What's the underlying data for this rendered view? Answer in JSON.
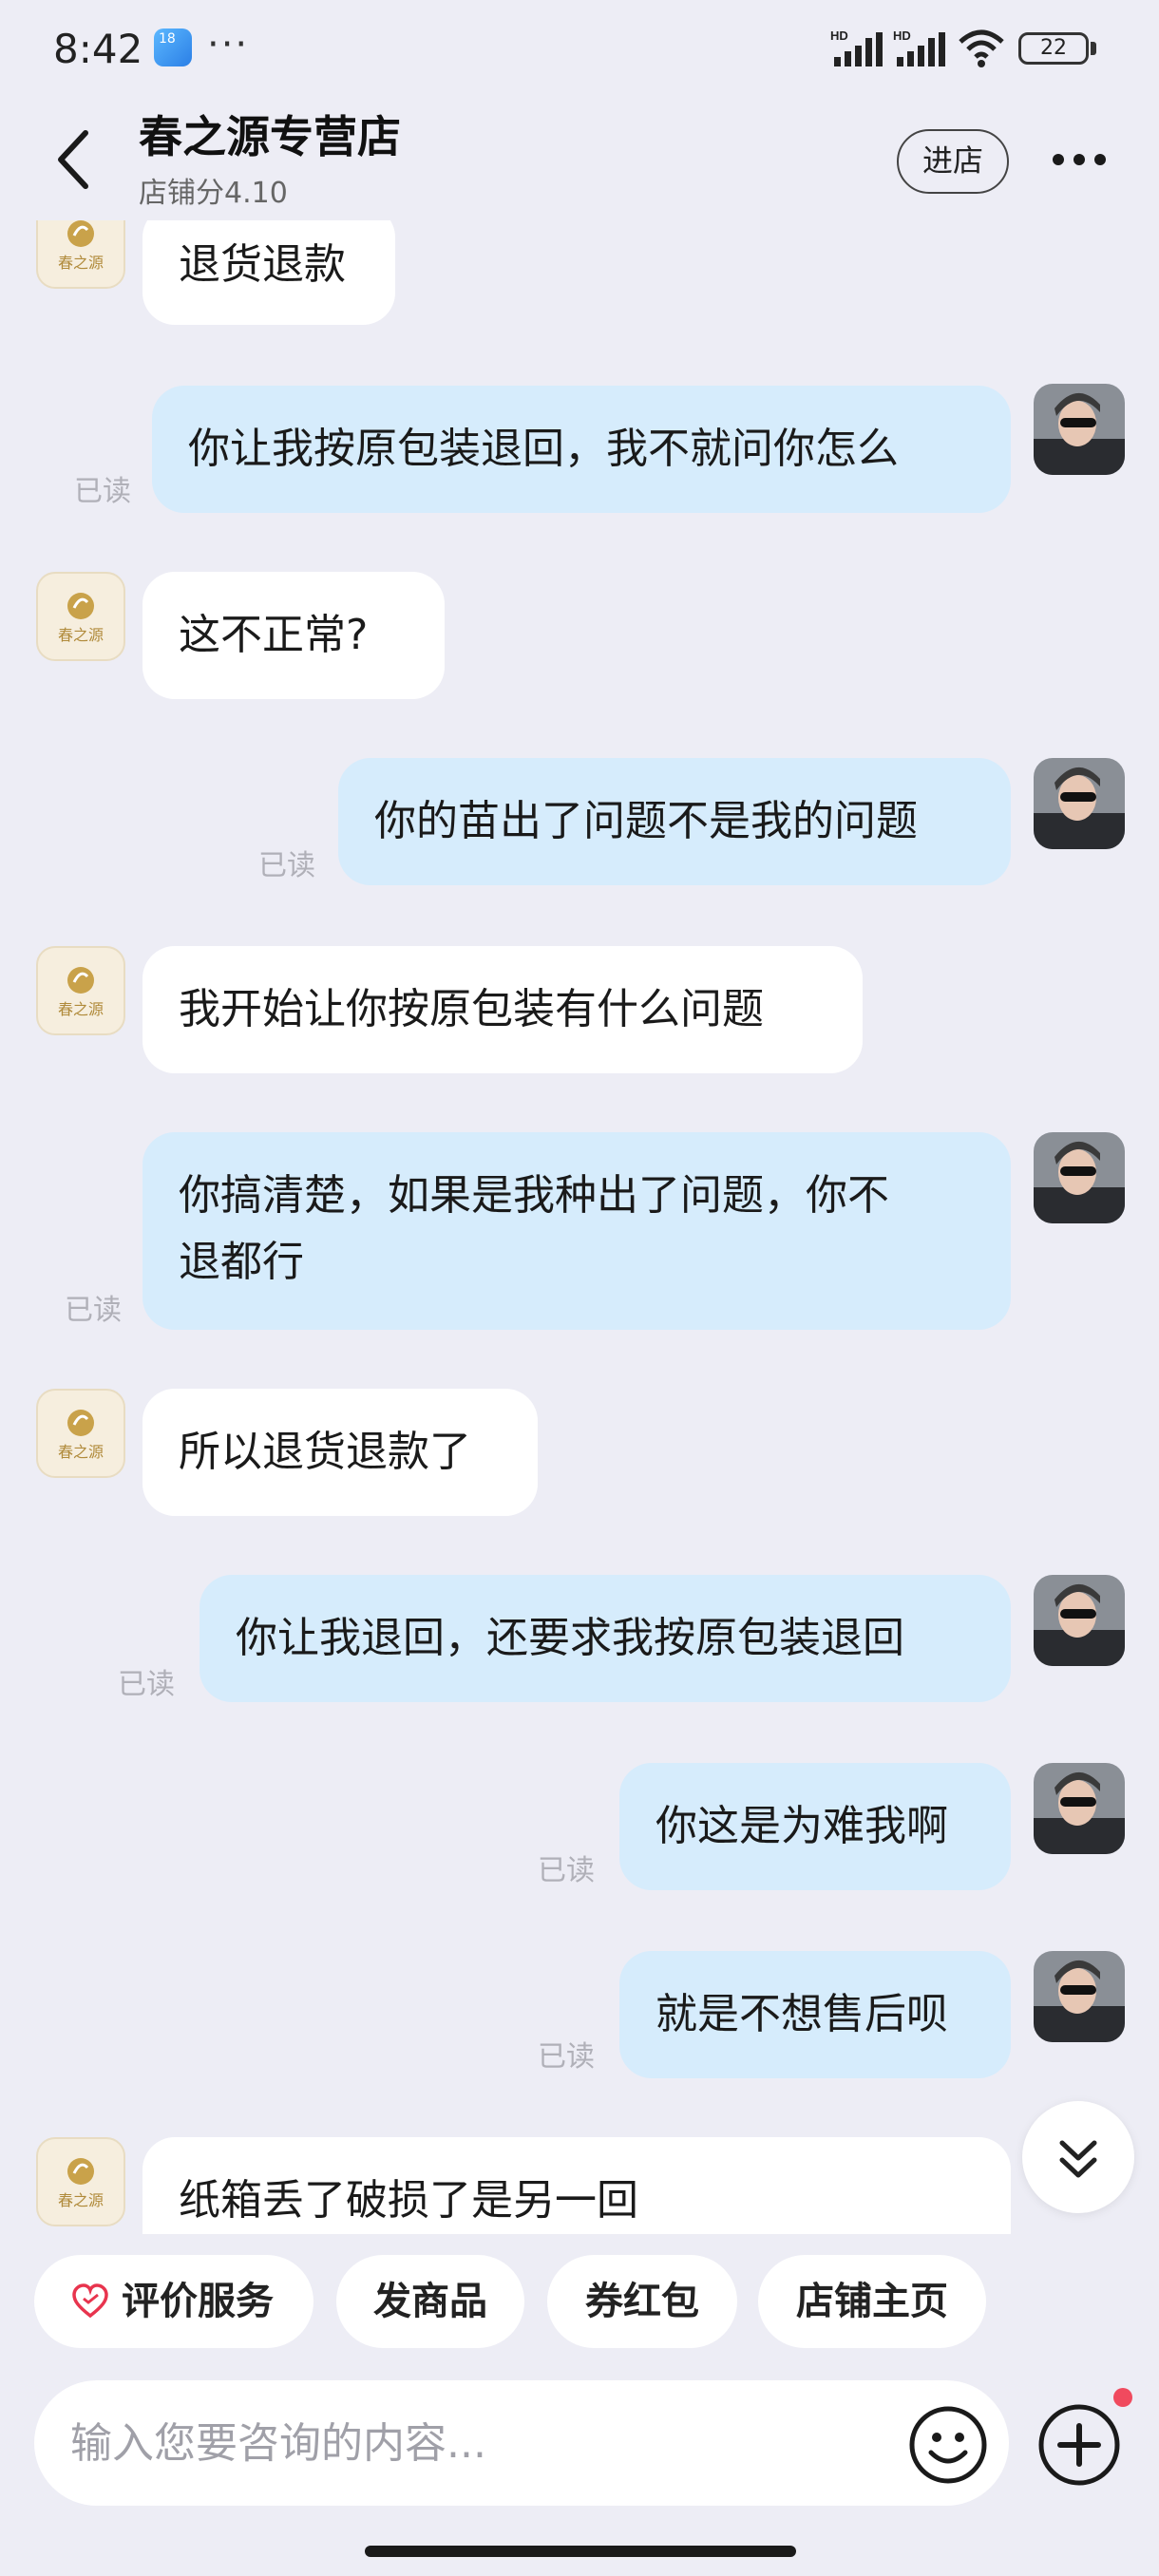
{
  "status_bar": {
    "time": "8:42",
    "badge": "18",
    "more": "···",
    "battery": "22",
    "signal_label": "HD"
  },
  "header": {
    "title": "春之源专营店",
    "score": "店铺分4.10",
    "enter_shop": "进店"
  },
  "shop_logo_text": "春之源",
  "messages": [
    {
      "from": "shop",
      "text": "退货退款"
    },
    {
      "from": "me",
      "text": "你让我按原包装退回，我不就问你怎么",
      "read": "已读"
    },
    {
      "from": "shop",
      "text": "这不正常?"
    },
    {
      "from": "me",
      "text": "你的苗出了问题不是我的问题",
      "read": "已读"
    },
    {
      "from": "shop",
      "text": "我开始让你按原包装有什么问题"
    },
    {
      "from": "me",
      "text_line1": "你搞清楚，如果是我种出了问题，你不",
      "text_line2": "退都行",
      "read": "已读"
    },
    {
      "from": "shop",
      "text": "所以退货退款了"
    },
    {
      "from": "me",
      "text": "你让我退回，还要求我按原包装退回",
      "read": "已读"
    },
    {
      "from": "me",
      "text": "你这是为难我啊",
      "read": "已读"
    },
    {
      "from": "me",
      "text": "就是不想售后呗",
      "read": "已读"
    },
    {
      "from": "shop",
      "text": "纸箱丢了破损了是另一回"
    }
  ],
  "quick_actions": {
    "rate": "评价服务",
    "send_product": "发商品",
    "coupon": "券红包",
    "shop_home": "店铺主页"
  },
  "input": {
    "placeholder": "输入您要咨询的内容..."
  },
  "colors": {
    "my_bubble": "#d6ecfc",
    "shop_bubble": "#ffffff",
    "background": "#ededf5",
    "notify": "#f04a5e"
  }
}
